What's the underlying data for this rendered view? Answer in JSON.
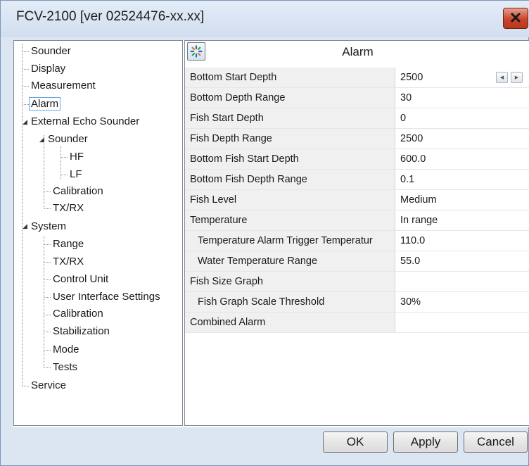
{
  "window": {
    "title": "FCV-2100 [ver 02524476-xx.xx]",
    "close_label": "✕"
  },
  "tree": {
    "items": [
      {
        "label": "Sounder"
      },
      {
        "label": "Display"
      },
      {
        "label": "Measurement"
      },
      {
        "label": "Alarm",
        "selected": true
      },
      {
        "label": "External Echo Sounder",
        "expanded": true
      },
      {
        "label": "Sounder",
        "expanded": true
      },
      {
        "label": "HF"
      },
      {
        "label": "LF"
      },
      {
        "label": "Calibration"
      },
      {
        "label": "TX/RX"
      },
      {
        "label": "System",
        "expanded": true
      },
      {
        "label": "Range"
      },
      {
        "label": "TX/RX"
      },
      {
        "label": "Control Unit"
      },
      {
        "label": "User Interface Settings"
      },
      {
        "label": "Calibration"
      },
      {
        "label": "Stabilization"
      },
      {
        "label": "Mode"
      },
      {
        "label": "Tests"
      },
      {
        "label": "Service"
      }
    ]
  },
  "panel": {
    "icon": "alarm-settings-icon",
    "title": "Alarm",
    "rows": [
      {
        "name": "Bottom Start Depth",
        "value": "2500"
      },
      {
        "name": "Bottom Depth Range",
        "value": "30"
      },
      {
        "name": "Fish Start Depth",
        "value": "0"
      },
      {
        "name": "Fish Depth Range",
        "value": "2500"
      },
      {
        "name": "Bottom Fish Start Depth",
        "value": "600.0"
      },
      {
        "name": "Bottom Fish Depth Range",
        "value": "0.1"
      },
      {
        "name": "Fish Level",
        "value": "Medium"
      },
      {
        "name": "Temperature",
        "value": "In range"
      },
      {
        "name": "Temperature Alarm Trigger Temperatur",
        "value": "110.0"
      },
      {
        "name": "Water Temperature Range",
        "value": "55.0"
      },
      {
        "name": "Fish Size Graph",
        "value": ""
      },
      {
        "name": "Fish Graph Scale Threshold",
        "value": "30%"
      },
      {
        "name": "Combined Alarm",
        "value": ""
      }
    ]
  },
  "buttons": {
    "ok": "OK",
    "apply": "Apply",
    "cancel": "Cancel"
  }
}
